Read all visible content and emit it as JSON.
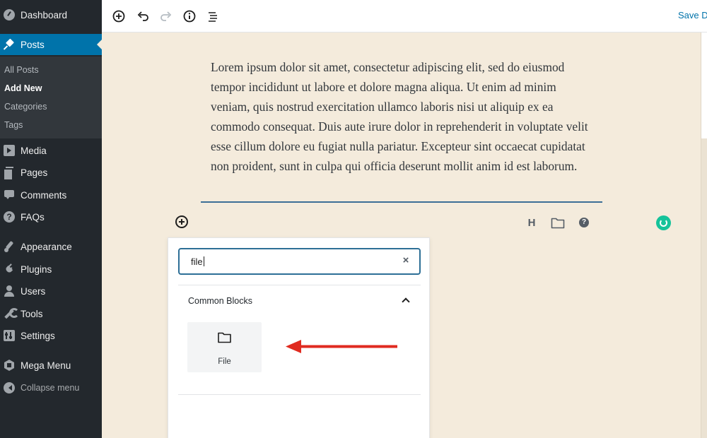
{
  "sidebar": {
    "menu": [
      {
        "label": "Dashboard",
        "icon": "dashboard-icon"
      },
      {
        "label": "Posts",
        "icon": "pushpin-icon",
        "active": true
      },
      {
        "label": "Media",
        "icon": "media-icon"
      },
      {
        "label": "Pages",
        "icon": "pages-icon"
      },
      {
        "label": "Comments",
        "icon": "comment-icon"
      },
      {
        "label": "FAQs",
        "icon": "question-icon"
      },
      {
        "label": "Appearance",
        "icon": "paintbrush-icon"
      },
      {
        "label": "Plugins",
        "icon": "plugin-icon"
      },
      {
        "label": "Users",
        "icon": "user-icon"
      },
      {
        "label": "Tools",
        "icon": "wrench-icon"
      },
      {
        "label": "Settings",
        "icon": "settings-icon"
      },
      {
        "label": "Mega Menu",
        "icon": "mega-menu-icon"
      }
    ],
    "submenu": [
      {
        "label": "All Posts"
      },
      {
        "label": "Add New",
        "current": true
      },
      {
        "label": "Categories"
      },
      {
        "label": "Tags"
      }
    ],
    "collapse_label": "Collapse menu"
  },
  "toolbar": {
    "buttons": [
      "add-block-icon",
      "undo-icon",
      "redo-icon",
      "info-icon",
      "list-view-icon"
    ],
    "save_label": "Save Dr"
  },
  "editor": {
    "paragraph": " Lorem ipsum dolor sit amet, consectetur adipiscing elit, sed do eiusmod tempor incididunt ut labore et dolore magna aliqua. Ut enim ad minim veniam, quis nostrud exercitation ullamco laboris nisi ut aliquip ex ea commodo consequat. Duis aute irure dolor in reprehenderit in voluptate velit esse cillum dolore eu fugiat nulla pariatur. Excepteur sint occaecat cupidatat non proident, sunt in culpa qui officia deserunt mollit anim id est laborum.",
    "sibling_heading_label": "H",
    "help_label": "?"
  },
  "inserter": {
    "search_value": "file",
    "clear_label": "×",
    "panel_title": "Common Blocks",
    "blocks": [
      {
        "label": "File",
        "icon": "folder-icon"
      }
    ]
  },
  "colors": {
    "sidebar_bg": "#23282d",
    "accent": "#0073aa",
    "canvas_bg": "#f4ebdc",
    "annotation_arrow": "#e02b20",
    "grammarly": "#15c39a"
  }
}
